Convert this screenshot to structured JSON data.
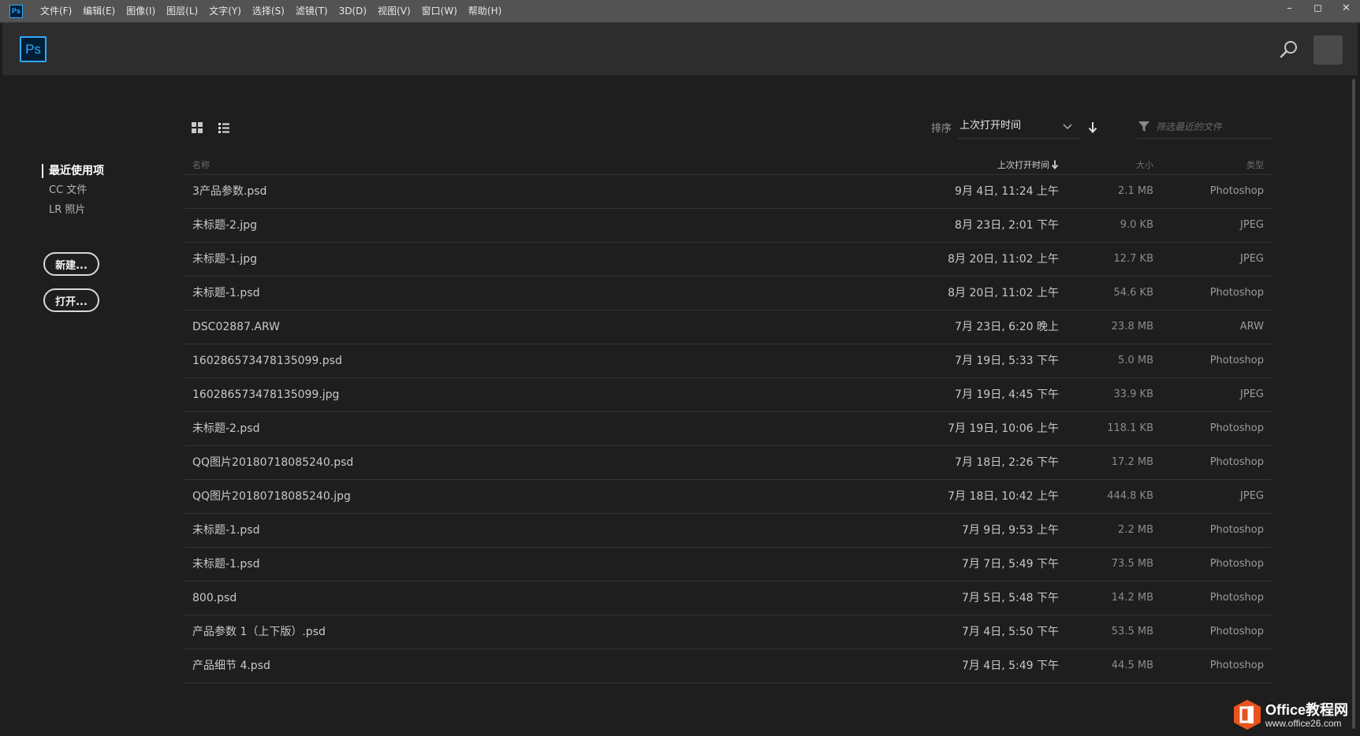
{
  "app": {
    "badge": "Ps"
  },
  "menu": [
    {
      "label": "文件(F)"
    },
    {
      "label": "编辑(E)"
    },
    {
      "label": "图像(I)"
    },
    {
      "label": "图层(L)"
    },
    {
      "label": "文字(Y)"
    },
    {
      "label": "选择(S)"
    },
    {
      "label": "滤镜(T)"
    },
    {
      "label": "3D(D)"
    },
    {
      "label": "视图(V)"
    },
    {
      "label": "窗口(W)"
    },
    {
      "label": "帮助(H)"
    }
  ],
  "window_controls": {
    "minimize": "–",
    "maximize": "◻",
    "close": "✕"
  },
  "header": {
    "logo": "Ps"
  },
  "sidebar": {
    "links": [
      {
        "label": "最近使用项",
        "active": true
      },
      {
        "label": "CC 文件",
        "active": false
      },
      {
        "label": "LR 照片",
        "active": false
      }
    ],
    "new_button": "新建...",
    "open_button": "打开..."
  },
  "toolbar": {
    "sort_label": "排序",
    "sort_value": "上次打开时间",
    "filter_placeholder": "筛选最近的文件"
  },
  "table": {
    "headers": {
      "name": "名称",
      "date": "上次打开时间",
      "size": "大小",
      "type": "类型"
    },
    "rows": [
      {
        "name": "3产品参数.psd",
        "date": "9月 4日, 11:24 上午",
        "size": "2.1 MB",
        "type": "Photoshop"
      },
      {
        "name": "未标题-2.jpg",
        "date": "8月 23日, 2:01 下午",
        "size": "9.0 KB",
        "type": "JPEG"
      },
      {
        "name": "未标题-1.jpg",
        "date": "8月 20日, 11:02 上午",
        "size": "12.7 KB",
        "type": "JPEG"
      },
      {
        "name": "未标题-1.psd",
        "date": "8月 20日, 11:02 上午",
        "size": "54.6 KB",
        "type": "Photoshop"
      },
      {
        "name": "DSC02887.ARW",
        "date": "7月 23日, 6:20 晚上",
        "size": "23.8 MB",
        "type": "ARW"
      },
      {
        "name": "160286573478135099.psd",
        "date": "7月 19日, 5:33 下午",
        "size": "5.0 MB",
        "type": "Photoshop"
      },
      {
        "name": "160286573478135099.jpg",
        "date": "7月 19日, 4:45 下午",
        "size": "33.9 KB",
        "type": "JPEG"
      },
      {
        "name": "未标题-2.psd",
        "date": "7月 19日, 10:06 上午",
        "size": "118.1 KB",
        "type": "Photoshop"
      },
      {
        "name": "QQ图片20180718085240.psd",
        "date": "7月 18日, 2:26 下午",
        "size": "17.2 MB",
        "type": "Photoshop"
      },
      {
        "name": "QQ图片20180718085240.jpg",
        "date": "7月 18日, 10:42 上午",
        "size": "444.8 KB",
        "type": "JPEG"
      },
      {
        "name": "未标题-1.psd",
        "date": "7月 9日, 9:53 上午",
        "size": "2.2 MB",
        "type": "Photoshop"
      },
      {
        "name": "未标题-1.psd",
        "date": "7月 7日, 5:49 下午",
        "size": "73.5 MB",
        "type": "Photoshop"
      },
      {
        "name": "800.psd",
        "date": "7月 5日, 5:48 下午",
        "size": "14.2 MB",
        "type": "Photoshop"
      },
      {
        "name": "产品参数 1（上下版）.psd",
        "date": "7月 4日, 5:50 下午",
        "size": "53.5 MB",
        "type": "Photoshop"
      },
      {
        "name": "产品细节 4.psd",
        "date": "7月 4日, 5:49 下午",
        "size": "44.5 MB",
        "type": "Photoshop"
      }
    ]
  },
  "watermark": {
    "title": "Office教程网",
    "url": "www.office26.com"
  },
  "colors": {
    "accent": "#31a8ff",
    "logo_bg": "#001e36",
    "watermark_orange": "#e8531e"
  }
}
